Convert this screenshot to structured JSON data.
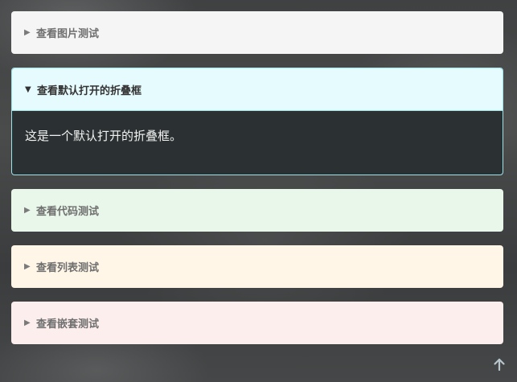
{
  "details": [
    {
      "label": "查看图片测试",
      "arrow": "▶"
    },
    {
      "label": "查看默认打开的折叠框",
      "arrow": "▼",
      "content": "这是一个默认打开的折叠框。"
    },
    {
      "label": "查看代码测试",
      "arrow": "▶"
    },
    {
      "label": "查看列表测试",
      "arrow": "▶"
    },
    {
      "label": "查看嵌套测试",
      "arrow": "▶"
    }
  ],
  "icons": {
    "back_to_top": "arrow-up-icon"
  },
  "colors": {
    "open_border": "#9be4ea",
    "open_header": "#e6fbfd",
    "gray": "#f5f5f5",
    "green": "#e9f7ea",
    "yellow": "#fff6e7",
    "pink": "#fdeeee"
  }
}
